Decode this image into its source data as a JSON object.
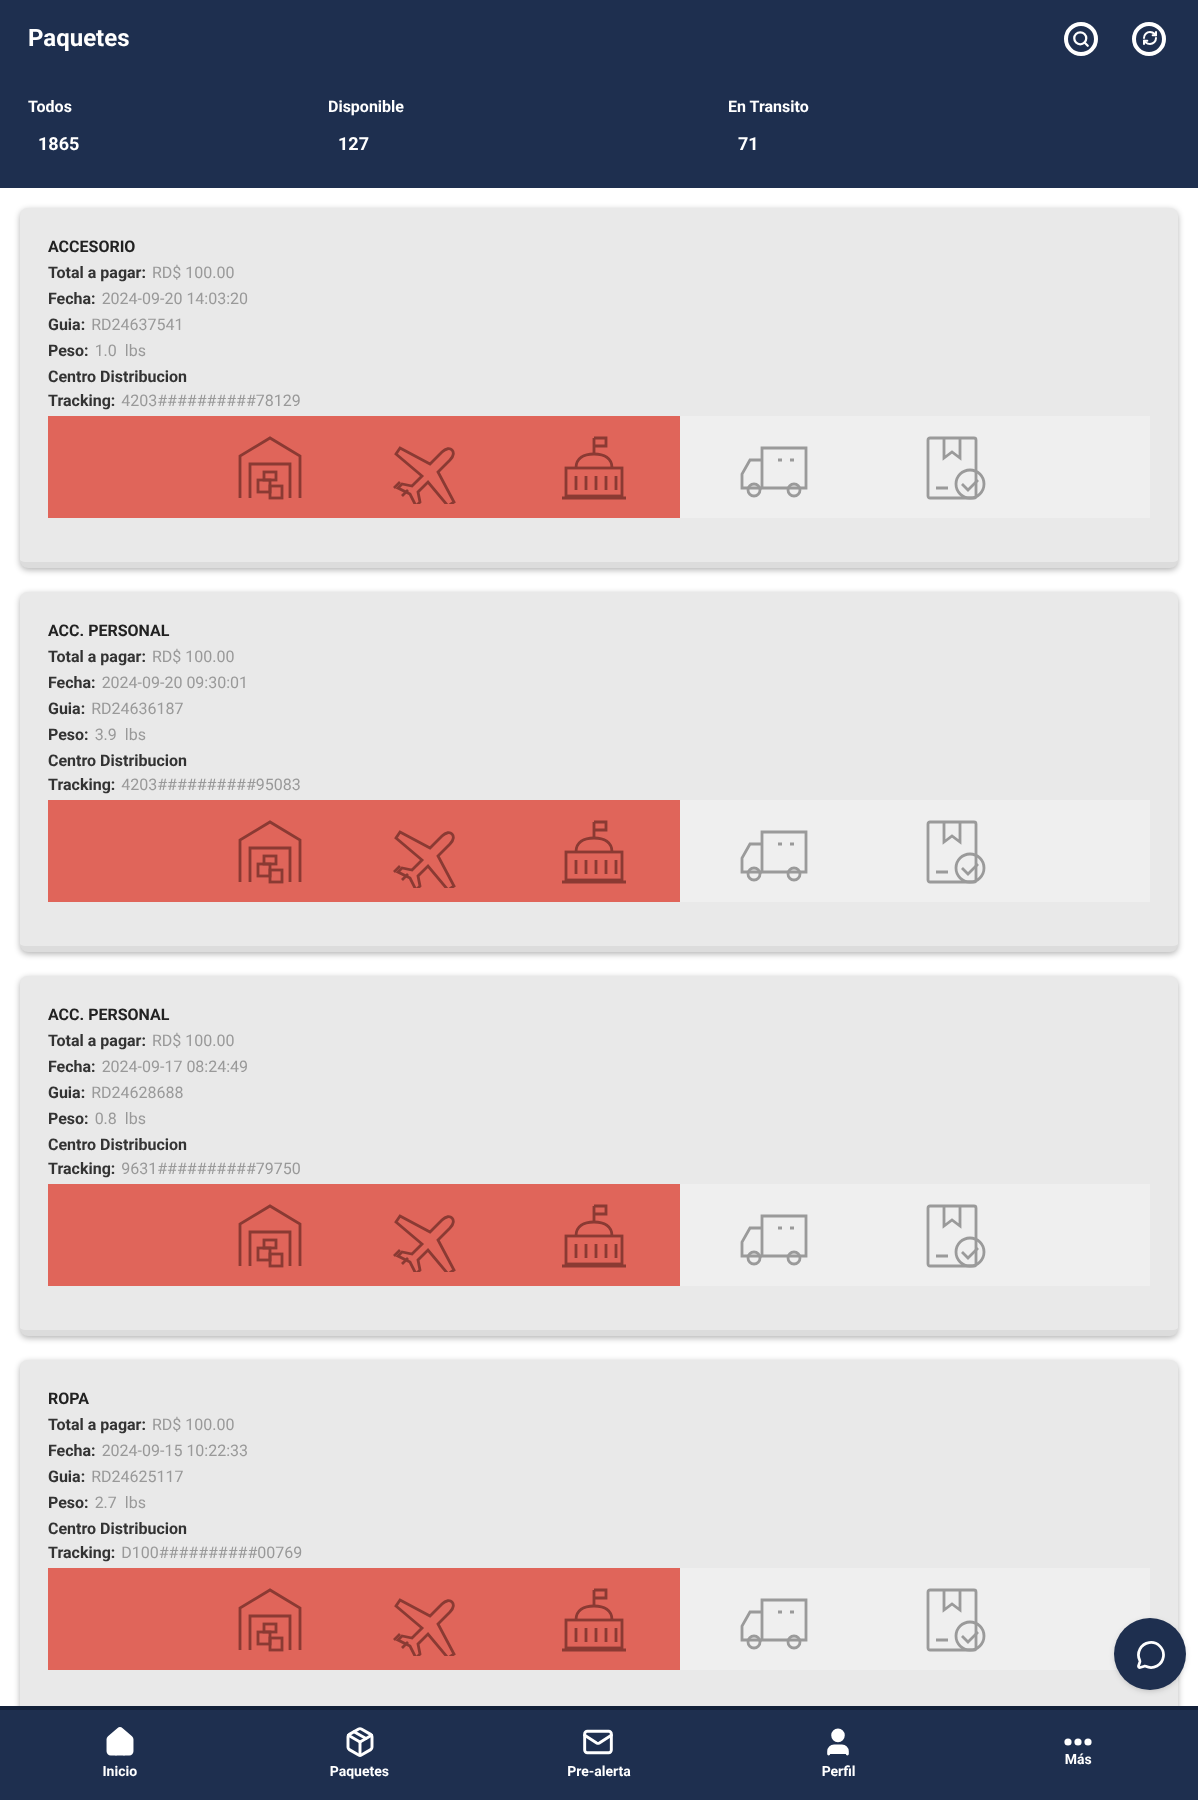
{
  "header": {
    "title": "Paquetes"
  },
  "summary": [
    {
      "label": "Todos",
      "count": "1865"
    },
    {
      "label": "Disponible",
      "count": "127"
    },
    {
      "label": "En Transito",
      "count": "71"
    }
  ],
  "packages": [
    {
      "category": "ACCESORIO",
      "total_label": "Total a pagar:",
      "total": "RD$ 100.00",
      "date_label": "Fecha:",
      "date": "2024-09-20 14:03:20",
      "guide_label": "Guia:",
      "guide": "RD24637541",
      "weight_label": "Peso:",
      "weight": "1.0  lbs",
      "center": "Centro Distribucion",
      "tracking_label": "Tracking:",
      "tracking": "4203##########78129",
      "stages": [
        {
          "kind": "warehouse",
          "done": true
        },
        {
          "kind": "plane",
          "done": true
        },
        {
          "kind": "customs",
          "done": true
        },
        {
          "kind": "truck",
          "done": false
        },
        {
          "kind": "delivered",
          "done": false
        }
      ]
    },
    {
      "category": "ACC. PERSONAL",
      "total_label": "Total a pagar:",
      "total": "RD$ 100.00",
      "date_label": "Fecha:",
      "date": "2024-09-20 09:30:01",
      "guide_label": "Guia:",
      "guide": "RD24636187",
      "weight_label": "Peso:",
      "weight": "3.9  lbs",
      "center": "Centro Distribucion",
      "tracking_label": "Tracking:",
      "tracking": "4203##########95083",
      "stages": [
        {
          "kind": "warehouse",
          "done": true
        },
        {
          "kind": "plane",
          "done": true
        },
        {
          "kind": "customs",
          "done": true
        },
        {
          "kind": "truck",
          "done": false
        },
        {
          "kind": "delivered",
          "done": false
        }
      ]
    },
    {
      "category": "ACC. PERSONAL",
      "total_label": "Total a pagar:",
      "total": "RD$ 100.00",
      "date_label": "Fecha:",
      "date": "2024-09-17 08:24:49",
      "guide_label": "Guia:",
      "guide": "RD24628688",
      "weight_label": "Peso:",
      "weight": "0.8  lbs",
      "center": "Centro Distribucion",
      "tracking_label": "Tracking:",
      "tracking": "9631##########79750",
      "stages": [
        {
          "kind": "warehouse",
          "done": true
        },
        {
          "kind": "plane",
          "done": true
        },
        {
          "kind": "customs",
          "done": true
        },
        {
          "kind": "truck",
          "done": false
        },
        {
          "kind": "delivered",
          "done": false
        }
      ]
    },
    {
      "category": "ROPA",
      "total_label": "Total a pagar:",
      "total": "RD$ 100.00",
      "date_label": "Fecha:",
      "date": "2024-09-15 10:22:33",
      "guide_label": "Guia:",
      "guide": "RD24625117",
      "weight_label": "Peso:",
      "weight": "2.7  lbs",
      "center": "Centro Distribucion",
      "tracking_label": "Tracking:",
      "tracking": "D100##########00769",
      "stages": [
        {
          "kind": "warehouse",
          "done": true
        },
        {
          "kind": "plane",
          "done": true
        },
        {
          "kind": "customs",
          "done": true
        },
        {
          "kind": "truck",
          "done": false
        },
        {
          "kind": "delivered",
          "done": false
        }
      ]
    }
  ],
  "nav": [
    {
      "kind": "home",
      "label": "Inicio"
    },
    {
      "kind": "package",
      "label": "Paquetes"
    },
    {
      "kind": "mail",
      "label": "Pre-alerta"
    },
    {
      "kind": "user",
      "label": "Perfil"
    },
    {
      "kind": "more",
      "label": "Más"
    }
  ]
}
